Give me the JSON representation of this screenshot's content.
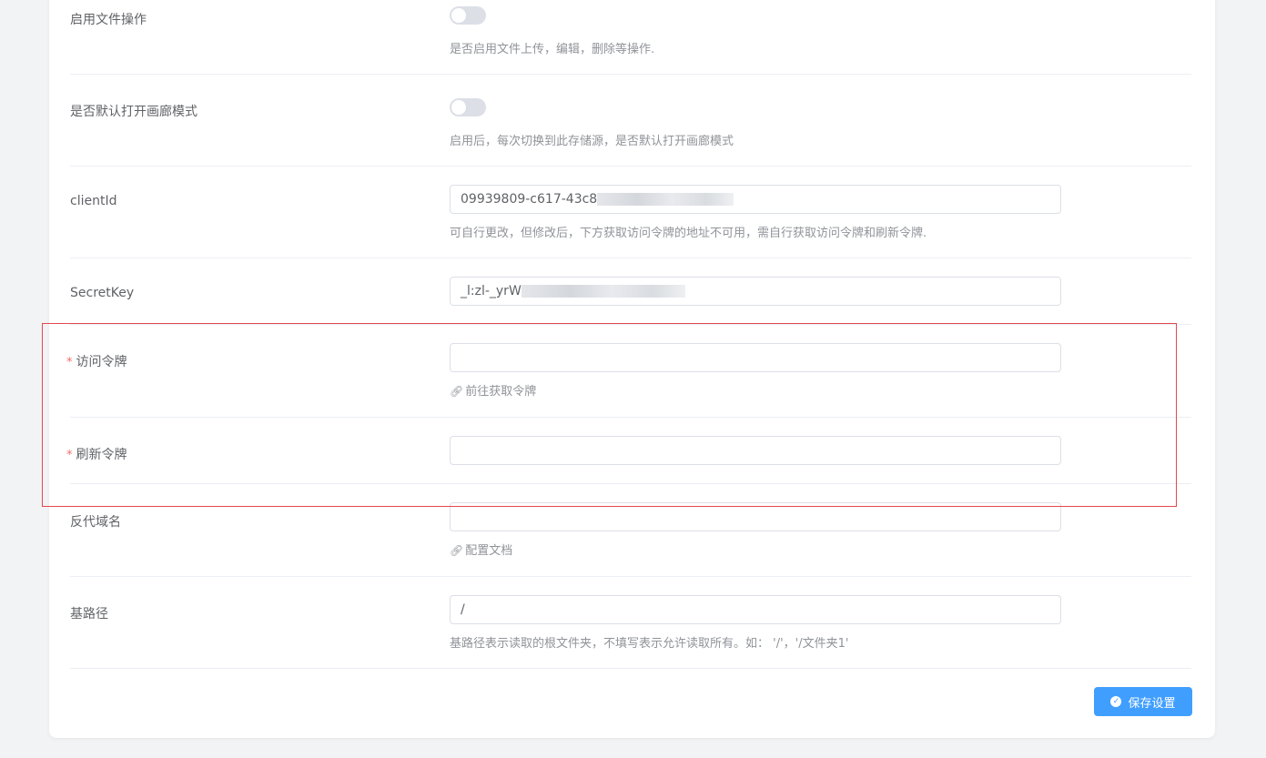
{
  "form": {
    "enable_file_ops": {
      "label": "启用文件操作",
      "enabled": false,
      "help": "是否启用文件上传，编辑，删除等操作."
    },
    "gallery_mode": {
      "label": "是否默认打开画廊模式",
      "enabled": false,
      "help": "启用后，每次切换到此存储源，是否默认打开画廊模式"
    },
    "client_id": {
      "label": "clientId",
      "value": "09939809-c617-43c8",
      "help": "可自行更改，但修改后，下方获取访问令牌的地址不可用，需自行获取访问令牌和刷新令牌."
    },
    "secret_key": {
      "label": "SecretKey",
      "value": "_l:zl-_yrW"
    },
    "access_token": {
      "required_mark": "*",
      "label": "访问令牌",
      "value": "",
      "link": "前往获取令牌"
    },
    "refresh_token": {
      "required_mark": "*",
      "label": "刷新令牌",
      "value": ""
    },
    "proxy_domain": {
      "label": "反代域名",
      "value": "",
      "link": "配置文档"
    },
    "base_path": {
      "label": "基路径",
      "value": "/",
      "help": "基路径表示读取的根文件夹，不填写表示允许读取所有。如： '/'，'/文件夹1'"
    }
  },
  "actions": {
    "save_label": "保存设置"
  },
  "colors": {
    "primary": "#409eff",
    "highlight_border": "#e5484d",
    "required": "#f56c6c"
  }
}
